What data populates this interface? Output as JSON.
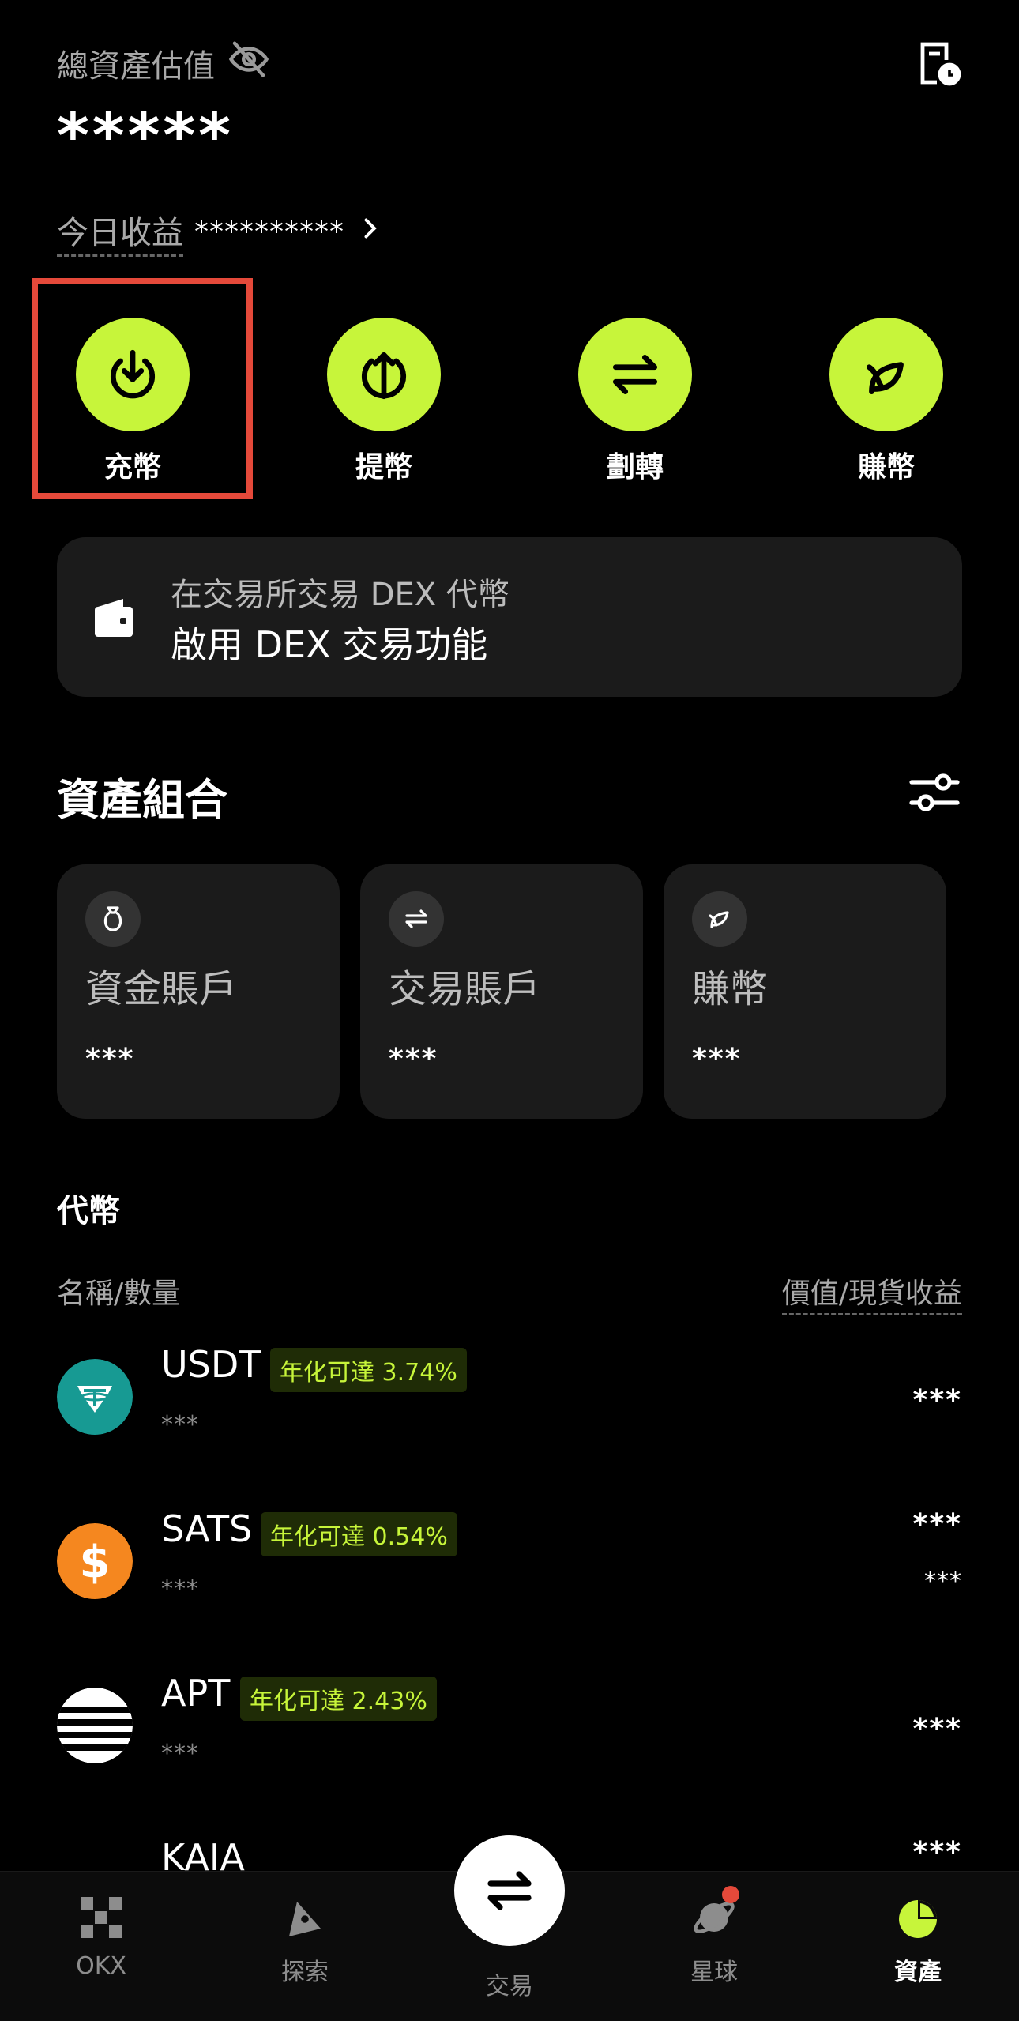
{
  "header": {
    "total_label": "總資產估值",
    "total_value": "*****",
    "today_pnl_label": "今日收益",
    "today_pnl_value": "**********"
  },
  "actions": [
    {
      "label": "充幣",
      "icon": "deposit-icon"
    },
    {
      "label": "提幣",
      "icon": "withdraw-icon"
    },
    {
      "label": "劃轉",
      "icon": "transfer-icon"
    },
    {
      "label": "賺幣",
      "icon": "earn-icon"
    }
  ],
  "dex_banner": {
    "line1": "在交易所交易 DEX 代幣",
    "line2": "啟用 DEX 交易功能"
  },
  "portfolio": {
    "title": "資產組合",
    "accounts": [
      {
        "name": "資金賬戶",
        "value": "***",
        "icon": "funding-bag-icon"
      },
      {
        "name": "交易賬戶",
        "value": "***",
        "icon": "swap-icon"
      },
      {
        "name": "賺幣",
        "value": "***",
        "icon": "leaf-icon"
      }
    ]
  },
  "tokens": {
    "title": "代幣",
    "col_left": "名稱/數量",
    "col_right": "價值/現貨收益",
    "items": [
      {
        "symbol": "USDT",
        "apy": "年化可達 3.74%",
        "qty": "***",
        "value": "***",
        "pnl": ""
      },
      {
        "symbol": "SATS",
        "apy": "年化可達 0.54%",
        "qty": "***",
        "value": "***",
        "pnl": "***"
      },
      {
        "symbol": "APT",
        "apy": "年化可達 2.43%",
        "qty": "***",
        "value": "***",
        "pnl": ""
      },
      {
        "symbol": "KAIA",
        "apy": "",
        "qty": "",
        "value": "***",
        "pnl": ""
      }
    ]
  },
  "bottom_nav": [
    {
      "label": "OKX"
    },
    {
      "label": "探索"
    },
    {
      "label": "交易"
    },
    {
      "label": "星球"
    },
    {
      "label": "資產"
    }
  ],
  "colors": {
    "accent": "#c7f53a",
    "highlight": "#e5493a",
    "card": "#1b1b1b"
  }
}
